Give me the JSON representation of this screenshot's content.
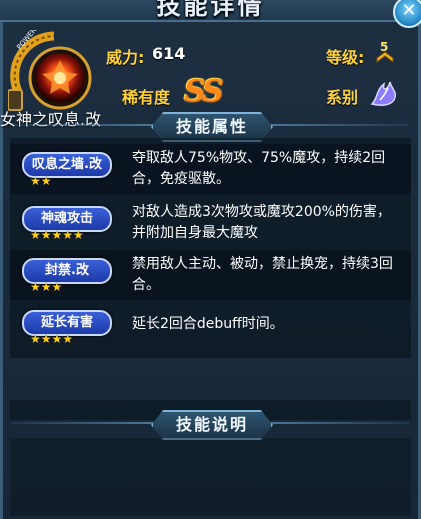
{
  "title": "技能详情",
  "skill": {
    "name": "女神之叹息.改",
    "power_label": "威力:",
    "power_value": "614",
    "level_label": "等级:",
    "level_value": "5",
    "rarity_label": "稀有度",
    "rarity_value": "SS",
    "series_label": "系别",
    "ring_text": "POWER"
  },
  "sections": {
    "attributes": "技能属性",
    "description": "技能说明"
  },
  "attributes": [
    {
      "name": "叹息之墙.改",
      "stars": "★★",
      "desc": "夺取敌人75%物攻、75%魔攻，持续2回合，免疫驱散。"
    },
    {
      "name": "神魂攻击",
      "stars": "★★★★★",
      "desc": "对敌人造成3次物攻或魔攻200%的伤害，并附加自身最大魔攻"
    },
    {
      "name": "封禁.改",
      "stars": "★★★",
      "desc": "禁用敌人主动、被动，禁止换宠，持续3回合。"
    },
    {
      "name": "延长有害",
      "stars": "★★★★",
      "desc": "延长2回合debuff时间。"
    }
  ],
  "colors": {
    "accent_gold": "#ffd23a",
    "badge_blue": "#2747c0",
    "rarity_orange": "#ff8a1a"
  }
}
